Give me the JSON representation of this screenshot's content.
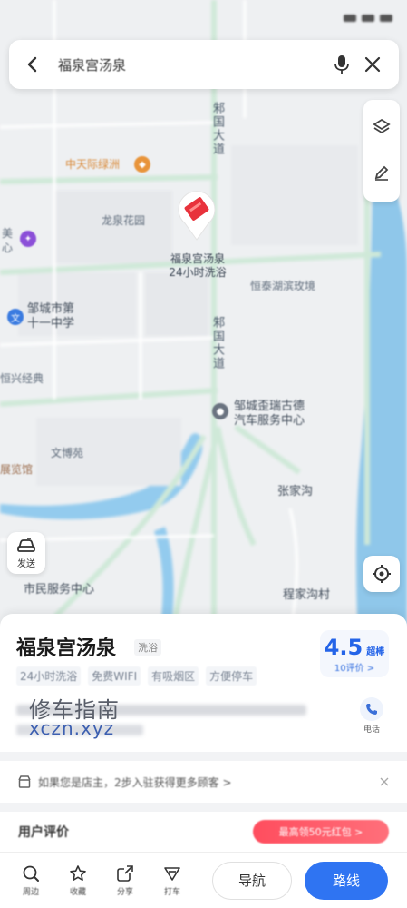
{
  "status_bar": {
    "time": ""
  },
  "search": {
    "query": "福泉宫汤泉"
  },
  "side_tools": [
    {
      "name": "layers-icon",
      "label": ""
    },
    {
      "name": "edit-icon",
      "label": ""
    }
  ],
  "map": {
    "poi": {
      "name": "福泉宫汤泉",
      "sub": "24小时洗浴"
    },
    "labels": {
      "zhongtian": "中天际绿洲",
      "longquan": "龙泉花园",
      "school_line1": "邹城市第",
      "school_line2": "十一中学",
      "mei": "美",
      "xin": "心",
      "hengxing": "恒兴经典",
      "hengtai": "恒泰湖滨玫境",
      "road1": "邾国大道",
      "road2": "邾国大道",
      "auto_line1": "邹城歪瑞古德",
      "auto_line2": "汽车服务中心",
      "wenbo": "文博苑",
      "zhanlan": "展览馆",
      "zhangjia": "张家沟",
      "chengjia": "程家沟村",
      "fuwu": "市民服务中心"
    },
    "send_label": "发送"
  },
  "sheet": {
    "title": "福泉宫汤泉",
    "category": "洗浴",
    "tags": [
      "24小时洗浴",
      "免费WIFI",
      "有吸烟区",
      "方便停车"
    ],
    "rating": {
      "score": "4.5",
      "grade": "超棒",
      "count": "10评价 >"
    },
    "watermark_cn": "修车指南",
    "watermark_en": "xczn.xyz",
    "phone_label": "电话",
    "owner_text": "如果您是店主，2步入驻获得更多顾客 >",
    "reviews_label": "用户评价",
    "promo_text": "最高领50元红包 >"
  },
  "toolbar": {
    "items": [
      {
        "name": "nearby-icon",
        "label": "周边"
      },
      {
        "name": "star-icon",
        "label": "收藏"
      },
      {
        "name": "share-icon",
        "label": "分享"
      },
      {
        "name": "taxi-icon",
        "label": "打车"
      }
    ],
    "nav_label": "导航",
    "route_label": "路线"
  },
  "colors": {
    "accent": "#2f74f2",
    "rating": "#2464e8",
    "marker": "#e8323c",
    "water": "#8fc7ea",
    "road": "#cde9d6"
  }
}
